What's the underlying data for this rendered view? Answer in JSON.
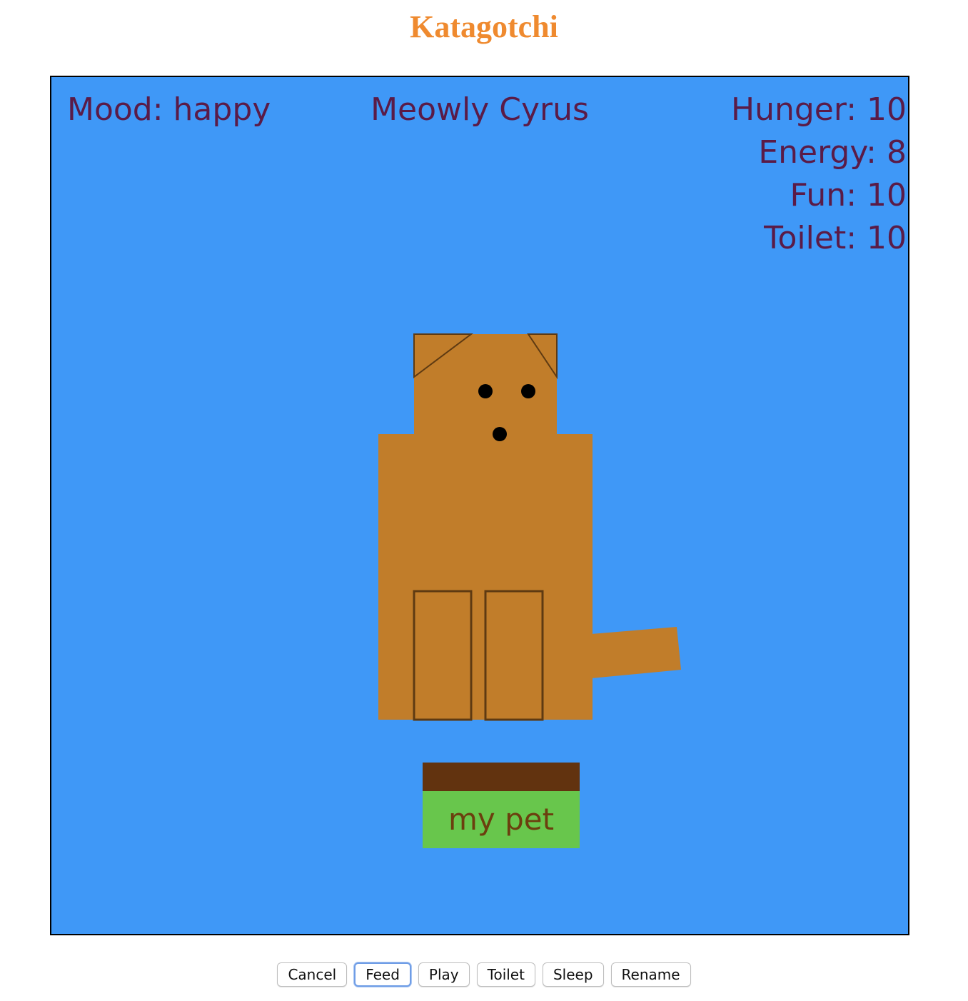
{
  "title": "Katagotchi",
  "hud": {
    "mood_label": "Mood: happy",
    "pet_name": "Meowly Cyrus",
    "stats": [
      {
        "label": "Hunger: 10"
      },
      {
        "label": "Energy: 8"
      },
      {
        "label": "Fun: 10"
      },
      {
        "label": "Toilet: 10"
      }
    ]
  },
  "name_plate": {
    "label": "my pet"
  },
  "colors": {
    "background": "#3f98f7",
    "pet_body": "#c17d2a",
    "text": "#5a1b47",
    "plate_top": "#62330f",
    "plate_label": "#68c64c",
    "title": "#ef8a2f"
  },
  "controls": {
    "buttons": [
      {
        "label": "Cancel"
      },
      {
        "label": "Feed"
      },
      {
        "label": "Play"
      },
      {
        "label": "Toilet"
      },
      {
        "label": "Sleep"
      },
      {
        "label": "Rename"
      }
    ]
  }
}
